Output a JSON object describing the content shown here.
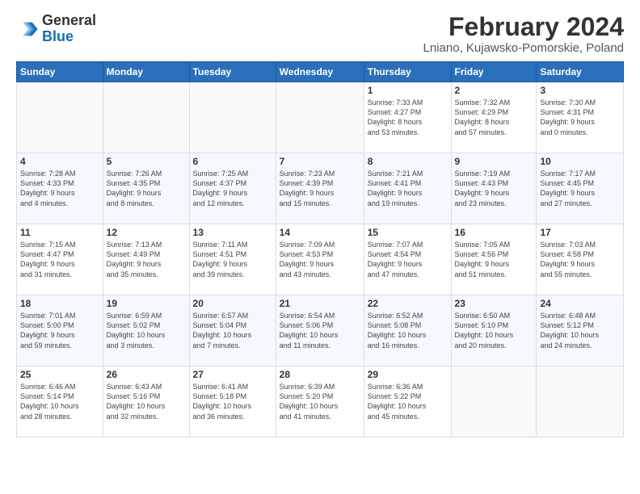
{
  "header": {
    "logo_general": "General",
    "logo_blue": "Blue",
    "month_title": "February 2024",
    "location": "Lniano, Kujawsko-Pomorskie, Poland"
  },
  "days_of_week": [
    "Sunday",
    "Monday",
    "Tuesday",
    "Wednesday",
    "Thursday",
    "Friday",
    "Saturday"
  ],
  "weeks": [
    [
      {
        "day": "",
        "info": ""
      },
      {
        "day": "",
        "info": ""
      },
      {
        "day": "",
        "info": ""
      },
      {
        "day": "",
        "info": ""
      },
      {
        "day": "1",
        "info": "Sunrise: 7:33 AM\nSunset: 4:27 PM\nDaylight: 8 hours\nand 53 minutes."
      },
      {
        "day": "2",
        "info": "Sunrise: 7:32 AM\nSunset: 4:29 PM\nDaylight: 8 hours\nand 57 minutes."
      },
      {
        "day": "3",
        "info": "Sunrise: 7:30 AM\nSunset: 4:31 PM\nDaylight: 9 hours\nand 0 minutes."
      }
    ],
    [
      {
        "day": "4",
        "info": "Sunrise: 7:28 AM\nSunset: 4:33 PM\nDaylight: 9 hours\nand 4 minutes."
      },
      {
        "day": "5",
        "info": "Sunrise: 7:26 AM\nSunset: 4:35 PM\nDaylight: 9 hours\nand 8 minutes."
      },
      {
        "day": "6",
        "info": "Sunrise: 7:25 AM\nSunset: 4:37 PM\nDaylight: 9 hours\nand 12 minutes."
      },
      {
        "day": "7",
        "info": "Sunrise: 7:23 AM\nSunset: 4:39 PM\nDaylight: 9 hours\nand 15 minutes."
      },
      {
        "day": "8",
        "info": "Sunrise: 7:21 AM\nSunset: 4:41 PM\nDaylight: 9 hours\nand 19 minutes."
      },
      {
        "day": "9",
        "info": "Sunrise: 7:19 AM\nSunset: 4:43 PM\nDaylight: 9 hours\nand 23 minutes."
      },
      {
        "day": "10",
        "info": "Sunrise: 7:17 AM\nSunset: 4:45 PM\nDaylight: 9 hours\nand 27 minutes."
      }
    ],
    [
      {
        "day": "11",
        "info": "Sunrise: 7:15 AM\nSunset: 4:47 PM\nDaylight: 9 hours\nand 31 minutes."
      },
      {
        "day": "12",
        "info": "Sunrise: 7:13 AM\nSunset: 4:49 PM\nDaylight: 9 hours\nand 35 minutes."
      },
      {
        "day": "13",
        "info": "Sunrise: 7:11 AM\nSunset: 4:51 PM\nDaylight: 9 hours\nand 39 minutes."
      },
      {
        "day": "14",
        "info": "Sunrise: 7:09 AM\nSunset: 4:53 PM\nDaylight: 9 hours\nand 43 minutes."
      },
      {
        "day": "15",
        "info": "Sunrise: 7:07 AM\nSunset: 4:54 PM\nDaylight: 9 hours\nand 47 minutes."
      },
      {
        "day": "16",
        "info": "Sunrise: 7:05 AM\nSunset: 4:56 PM\nDaylight: 9 hours\nand 51 minutes."
      },
      {
        "day": "17",
        "info": "Sunrise: 7:03 AM\nSunset: 4:58 PM\nDaylight: 9 hours\nand 55 minutes."
      }
    ],
    [
      {
        "day": "18",
        "info": "Sunrise: 7:01 AM\nSunset: 5:00 PM\nDaylight: 9 hours\nand 59 minutes."
      },
      {
        "day": "19",
        "info": "Sunrise: 6:59 AM\nSunset: 5:02 PM\nDaylight: 10 hours\nand 3 minutes."
      },
      {
        "day": "20",
        "info": "Sunrise: 6:57 AM\nSunset: 5:04 PM\nDaylight: 10 hours\nand 7 minutes."
      },
      {
        "day": "21",
        "info": "Sunrise: 6:54 AM\nSunset: 5:06 PM\nDaylight: 10 hours\nand 11 minutes."
      },
      {
        "day": "22",
        "info": "Sunrise: 6:52 AM\nSunset: 5:08 PM\nDaylight: 10 hours\nand 16 minutes."
      },
      {
        "day": "23",
        "info": "Sunrise: 6:50 AM\nSunset: 5:10 PM\nDaylight: 10 hours\nand 20 minutes."
      },
      {
        "day": "24",
        "info": "Sunrise: 6:48 AM\nSunset: 5:12 PM\nDaylight: 10 hours\nand 24 minutes."
      }
    ],
    [
      {
        "day": "25",
        "info": "Sunrise: 6:46 AM\nSunset: 5:14 PM\nDaylight: 10 hours\nand 28 minutes."
      },
      {
        "day": "26",
        "info": "Sunrise: 6:43 AM\nSunset: 5:16 PM\nDaylight: 10 hours\nand 32 minutes."
      },
      {
        "day": "27",
        "info": "Sunrise: 6:41 AM\nSunset: 5:18 PM\nDaylight: 10 hours\nand 36 minutes."
      },
      {
        "day": "28",
        "info": "Sunrise: 6:39 AM\nSunset: 5:20 PM\nDaylight: 10 hours\nand 41 minutes."
      },
      {
        "day": "29",
        "info": "Sunrise: 6:36 AM\nSunset: 5:22 PM\nDaylight: 10 hours\nand 45 minutes."
      },
      {
        "day": "",
        "info": ""
      },
      {
        "day": "",
        "info": ""
      }
    ]
  ]
}
